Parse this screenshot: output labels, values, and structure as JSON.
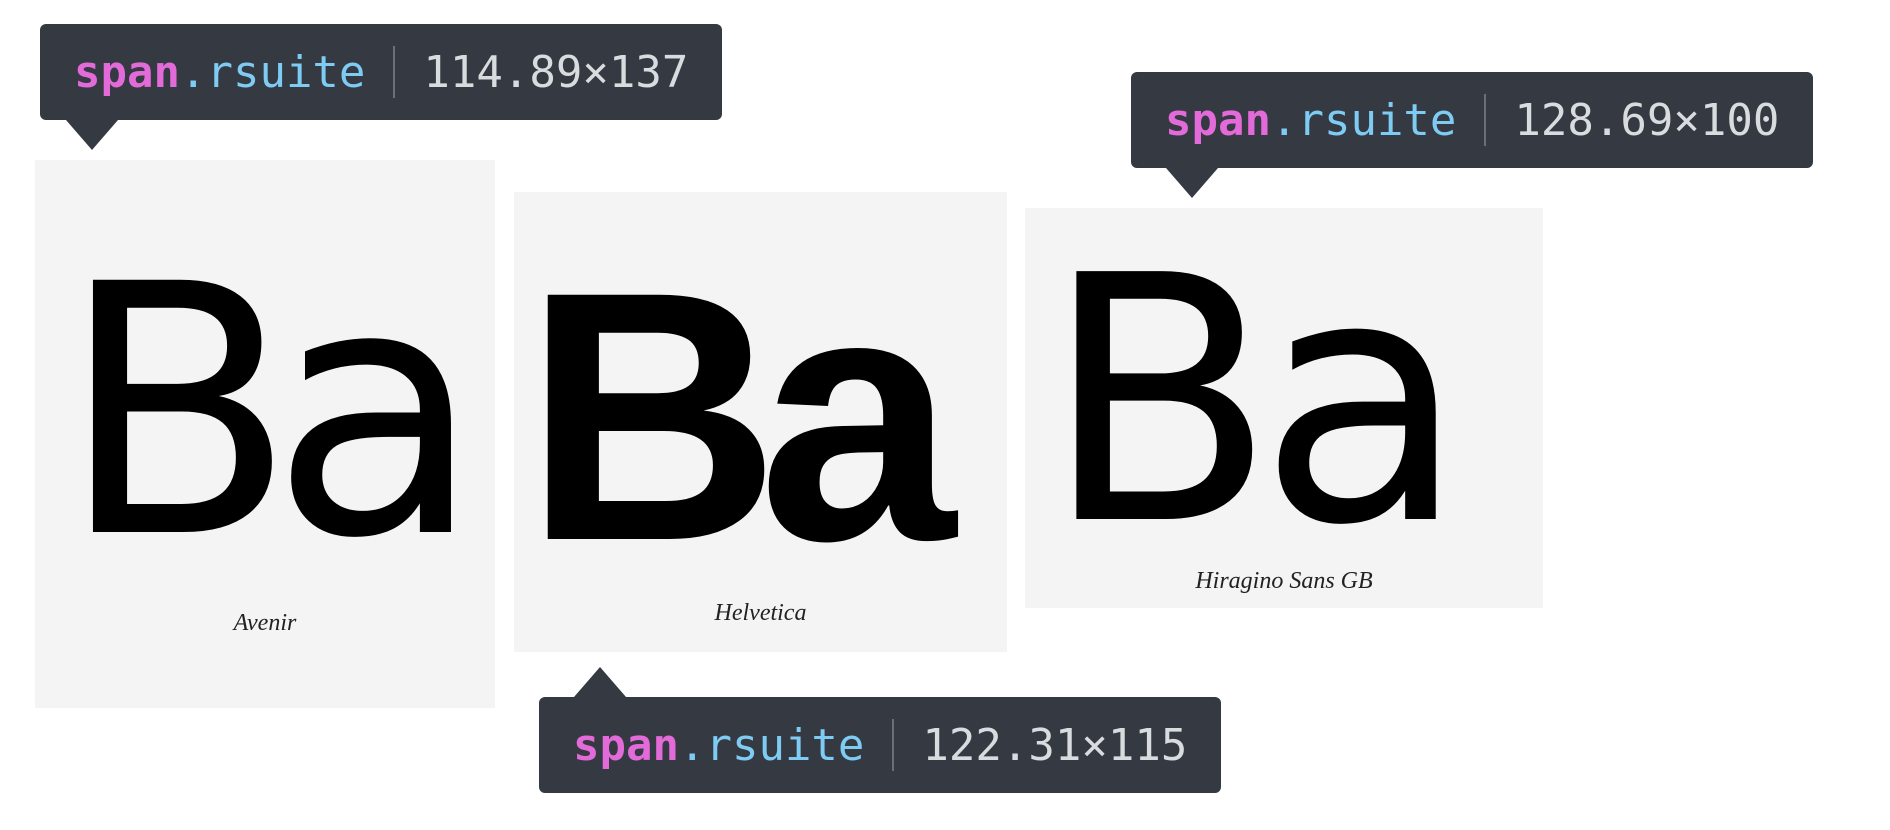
{
  "specimens": [
    {
      "glyphs": "Ba",
      "caption": "Avenir"
    },
    {
      "glyphs": "Ba",
      "caption": "Helvetica"
    },
    {
      "glyphs": "Ba",
      "caption": "Hiragino Sans GB"
    }
  ],
  "tooltips": [
    {
      "tag": "span",
      "dot": ".",
      "class_name": "rsuite",
      "dimensions": "114.89×137"
    },
    {
      "tag": "span",
      "dot": ".",
      "class_name": "rsuite",
      "dimensions": "128.69×100"
    },
    {
      "tag": "span",
      "dot": ".",
      "class_name": "rsuite",
      "dimensions": "122.31×115"
    }
  ],
  "colors": {
    "tooltip_bg": "#353942",
    "tag": "#e36ad9",
    "class": "#7ecbf4",
    "dimensions": "#d9dcdf",
    "panel_bg": "#f4f4f4"
  }
}
